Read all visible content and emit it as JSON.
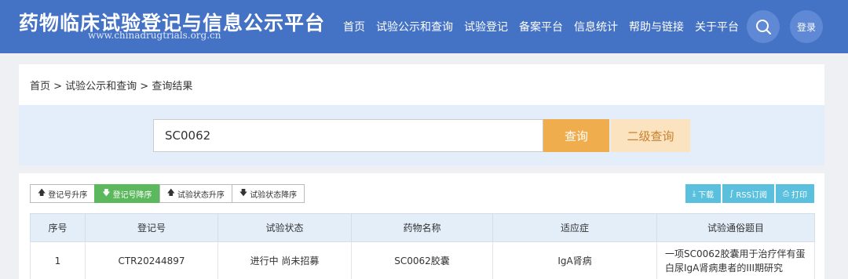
{
  "header": {
    "title": "药物临床试验登记与信息公示平台",
    "url": "www.chinadrugtrials.org.cn",
    "nav": [
      "首页",
      "试验公示和查询",
      "试验登记",
      "备案平台",
      "信息统计",
      "帮助与链接",
      "关于平台"
    ],
    "login_label": "登录",
    "accent_color": "#4472c4"
  },
  "breadcrumb": "首页 > 试验公示和查询 > 查询结果",
  "search": {
    "value": "SC0062",
    "query_label": "查询",
    "advanced_label": "二级查询"
  },
  "sort_buttons": [
    {
      "icon": "arrow-up-icon",
      "label": "登记号升序"
    },
    {
      "icon": "arrow-down-icon",
      "label": "登记号降序"
    },
    {
      "icon": "arrow-up-icon",
      "label": "试验状态升序"
    },
    {
      "icon": "arrow-down-icon",
      "label": "试验状态降序"
    }
  ],
  "action_buttons": [
    {
      "icon": "download-icon",
      "label": "下载"
    },
    {
      "icon": "rss-icon",
      "label": "RSS订阅"
    },
    {
      "icon": "print-icon",
      "label": "打印"
    }
  ],
  "table": {
    "headers": [
      "序号",
      "登记号",
      "试验状态",
      "药物名称",
      "适应症",
      "试验通俗题目"
    ],
    "rows": [
      [
        "1",
        "CTR20244897",
        "进行中 尚未招募",
        "SC0062胶囊",
        "IgA肾病",
        "一项SC0062胶囊用于治疗伴有蛋白尿IgA肾病患者的III期研究"
      ]
    ]
  }
}
